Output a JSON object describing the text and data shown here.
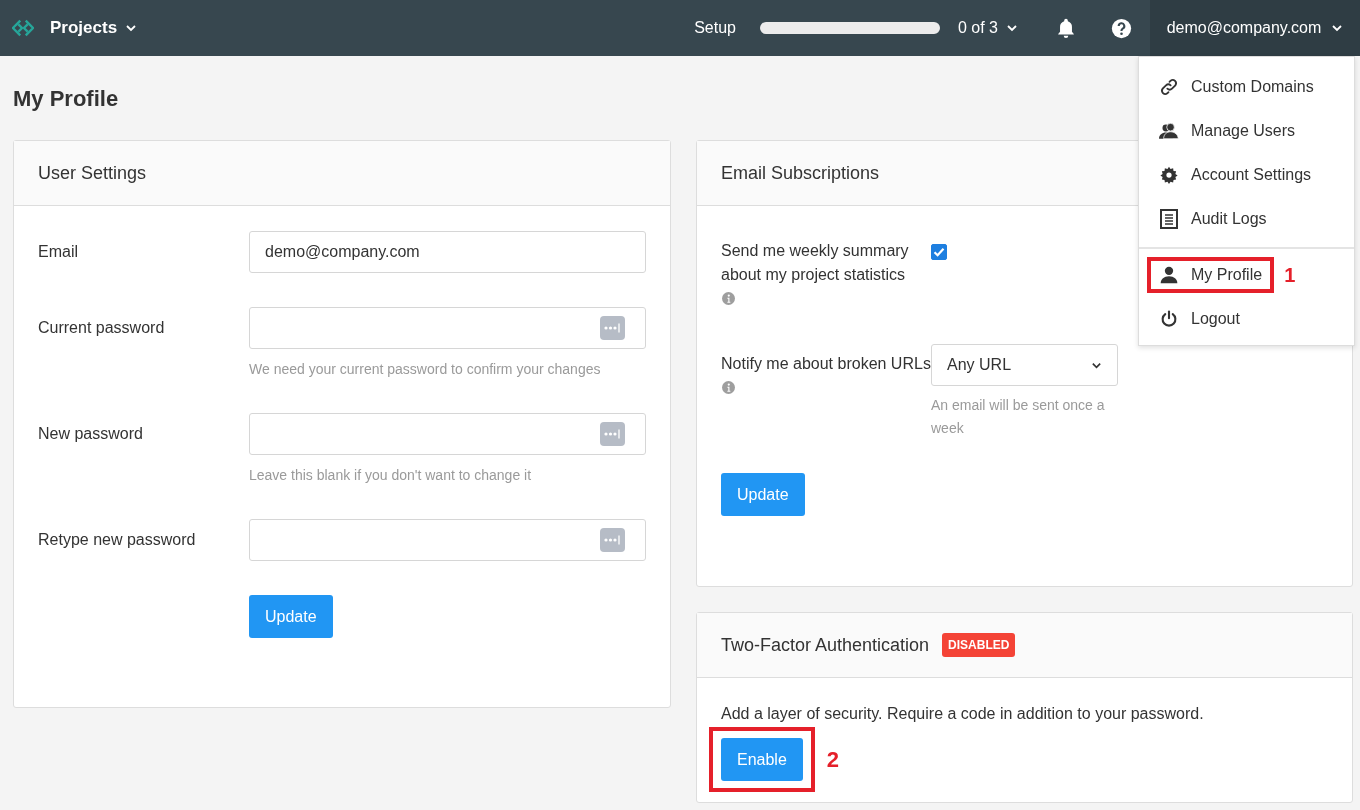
{
  "topbar": {
    "project_menu": "Projects",
    "setup": {
      "label": "Setup",
      "level": 0,
      "count": "0 of 3"
    },
    "user": "demo@company.com"
  },
  "user_menu": {
    "groups": [
      [
        {
          "label": "Custom Domains",
          "kind": "link"
        },
        {
          "label": "Manage Users",
          "kind": "users"
        },
        {
          "label": "Account Settings",
          "kind": "settings"
        },
        {
          "label": "Audit Logs",
          "kind": "logs"
        }
      ],
      [
        {
          "label": "My Profile",
          "kind": "profile",
          "callout": "1"
        },
        {
          "label": "Logout",
          "kind": "logout"
        }
      ]
    ]
  },
  "page_title": "My Profile",
  "user_settings": {
    "title": "User Settings",
    "fields": [
      {
        "label": "Email",
        "kind": "text",
        "value": "demo@company.com"
      },
      {
        "label": "Current password",
        "kind": "password",
        "hint": "We need your current password to confirm your changes"
      },
      {
        "label": "New password",
        "kind": "password",
        "hint": "Leave this blank if you don't want to change it"
      },
      {
        "label": "Retype new password",
        "kind": "password"
      }
    ],
    "button": "Update"
  },
  "email_subscriptions": {
    "title": "Email Subscriptions",
    "rows": [
      {
        "kind": "checkbox",
        "label": "Send me weekly summary about my project statistics",
        "checked": true
      },
      {
        "kind": "select",
        "label": "Notify me about broken URLs",
        "value": "Any URL",
        "hint": "An email will be sent once a week"
      }
    ],
    "button": "Update"
  },
  "two_factor": {
    "title": "Two-Factor Authentication",
    "status": "DISABLED",
    "enabled": false,
    "description": "Add a layer of security. Require a code in addition to your password.",
    "button": "Enable",
    "callout": "2"
  }
}
